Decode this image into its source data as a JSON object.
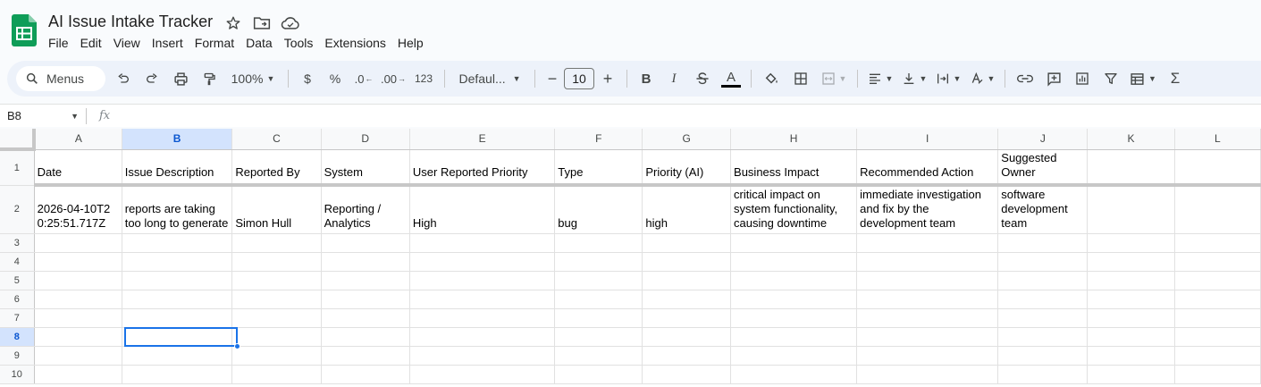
{
  "doc": {
    "title": "AI Issue Intake Tracker"
  },
  "menu": [
    "File",
    "Edit",
    "View",
    "Insert",
    "Format",
    "Data",
    "Tools",
    "Extensions",
    "Help"
  ],
  "toolbar": {
    "search_label": "Menus",
    "zoom": "100%",
    "currency": "$",
    "percent": "%",
    "dec_decrease": ".0",
    "dec_increase": ".00",
    "number_format": "123",
    "font": "Defaul...",
    "font_size": "10",
    "bold": "B",
    "italic": "I",
    "text_color": "A"
  },
  "formula_bar": {
    "cell_ref": "B8",
    "fx": "fx",
    "content": ""
  },
  "grid": {
    "columns": [
      "A",
      "B",
      "C",
      "D",
      "E",
      "F",
      "G",
      "H",
      "I",
      "J",
      "K",
      "L"
    ],
    "selected_column": "B",
    "selected_row": "8",
    "rows": [
      {
        "num": "1",
        "cells": [
          "Date",
          "Issue Description",
          "Reported By",
          "System",
          "User Reported Priority",
          "Type",
          "Priority (AI)",
          "Business Impact",
          "Recommended Action",
          "Suggested Owner",
          "",
          ""
        ]
      },
      {
        "num": "2",
        "cells": [
          "2026-04-10T20:25:51.717Z",
          "reports are taking too long to generate",
          "Simon Hull",
          "Reporting / Analytics",
          "High",
          "bug",
          "high",
          "critical impact on system functionality, causing downtime",
          "immediate investigation and fix by the development team",
          "software development team",
          "",
          ""
        ]
      },
      {
        "num": "3",
        "cells": [
          "",
          "",
          "",
          "",
          "",
          "",
          "",
          "",
          "",
          "",
          "",
          ""
        ]
      },
      {
        "num": "4",
        "cells": [
          "",
          "",
          "",
          "",
          "",
          "",
          "",
          "",
          "",
          "",
          "",
          ""
        ]
      },
      {
        "num": "5",
        "cells": [
          "",
          "",
          "",
          "",
          "",
          "",
          "",
          "",
          "",
          "",
          "",
          ""
        ]
      },
      {
        "num": "6",
        "cells": [
          "",
          "",
          "",
          "",
          "",
          "",
          "",
          "",
          "",
          "",
          "",
          ""
        ]
      },
      {
        "num": "7",
        "cells": [
          "",
          "",
          "",
          "",
          "",
          "",
          "",
          "",
          "",
          "",
          "",
          ""
        ]
      },
      {
        "num": "8",
        "cells": [
          "",
          "",
          "",
          "",
          "",
          "",
          "",
          "",
          "",
          "",
          "",
          ""
        ]
      },
      {
        "num": "9",
        "cells": [
          "",
          "",
          "",
          "",
          "",
          "",
          "",
          "",
          "",
          "",
          "",
          ""
        ]
      },
      {
        "num": "10",
        "cells": [
          "",
          "",
          "",
          "",
          "",
          "",
          "",
          "",
          "",
          "",
          "",
          ""
        ]
      }
    ]
  },
  "colors": {
    "accent": "#1a73e8",
    "sheets_green": "#0f9d58",
    "selected_header": "#d3e3fd"
  }
}
